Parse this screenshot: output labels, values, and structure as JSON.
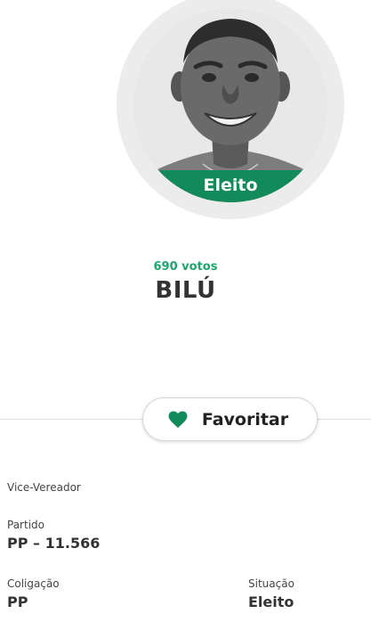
{
  "candidate": {
    "status_badge": "Eleito",
    "votes": "690 votos",
    "name": "BILÚ",
    "role": "Vice-Vereador"
  },
  "favorite_button": {
    "label": "Favoritar",
    "icon": "heart-icon",
    "icon_color": "#128a5a"
  },
  "details": {
    "party_label": "Partido",
    "party_value": "PP – 11.566",
    "coalition_label": "Coligação",
    "coalition_value": "PP",
    "situation_label": "Situação",
    "situation_value": "Eleito"
  },
  "colors": {
    "accent_green": "#128a5a",
    "votes_green": "#1aa86b",
    "text_dark": "#333333"
  }
}
